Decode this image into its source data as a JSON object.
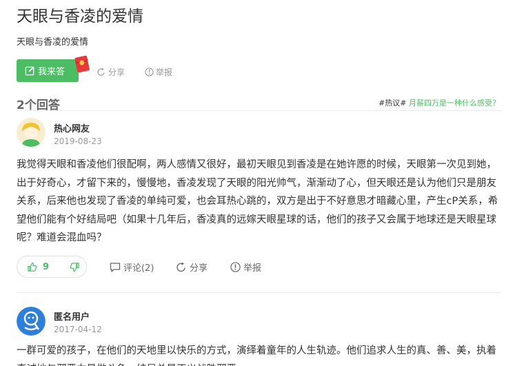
{
  "question": {
    "title": "天眼与香凌的爱情",
    "description": "天眼与香凌的爱情",
    "answer_button": "我来答",
    "share": "分享",
    "report": "举报"
  },
  "answers_header": "2个回答",
  "hot_topic": {
    "tag": "#热议#",
    "link": "月薪四万是一种什么感受？"
  },
  "answers": [
    {
      "user": "热心网友",
      "date": "2019-08-23",
      "text": "我觉得天眼和香凌他们很配啊，两人感情又很好，最初天眼见到香凌是在她许愿的时候，天眼第一次见到她，出于好奇心，才留下来的，慢慢地，香凌发现了天眼的阳光帅气，渐渐动了心，但天眼还是认为他们只是朋友关系，后来他也发现了香凌的单纯可爱，也会耳热心跳的，双方是出于不好意思才暗藏心里，产生cP关系，希望他们能有个好结局吧（如果十几年后，香凌真的远嫁天眼星球的话，他们的孩子又会属于地球还是天眼星球呢？难道会混血吗？",
      "likes": "9",
      "comment": "评论(2)",
      "share": "分享",
      "report": "举报"
    },
    {
      "user": "匿名用户",
      "date": "2017-04-12",
      "text": "一群可爱的孩子，在他们的天地里以快乐的方式，演绎着童年的人生轨迹。他们追求人生的真、善、美，执着真诚地与邪恶力量做斗争，结局总是正义战胜邪恶。"
    }
  ],
  "colors": {
    "accent": "#4cbd64",
    "muted": "#999999"
  }
}
